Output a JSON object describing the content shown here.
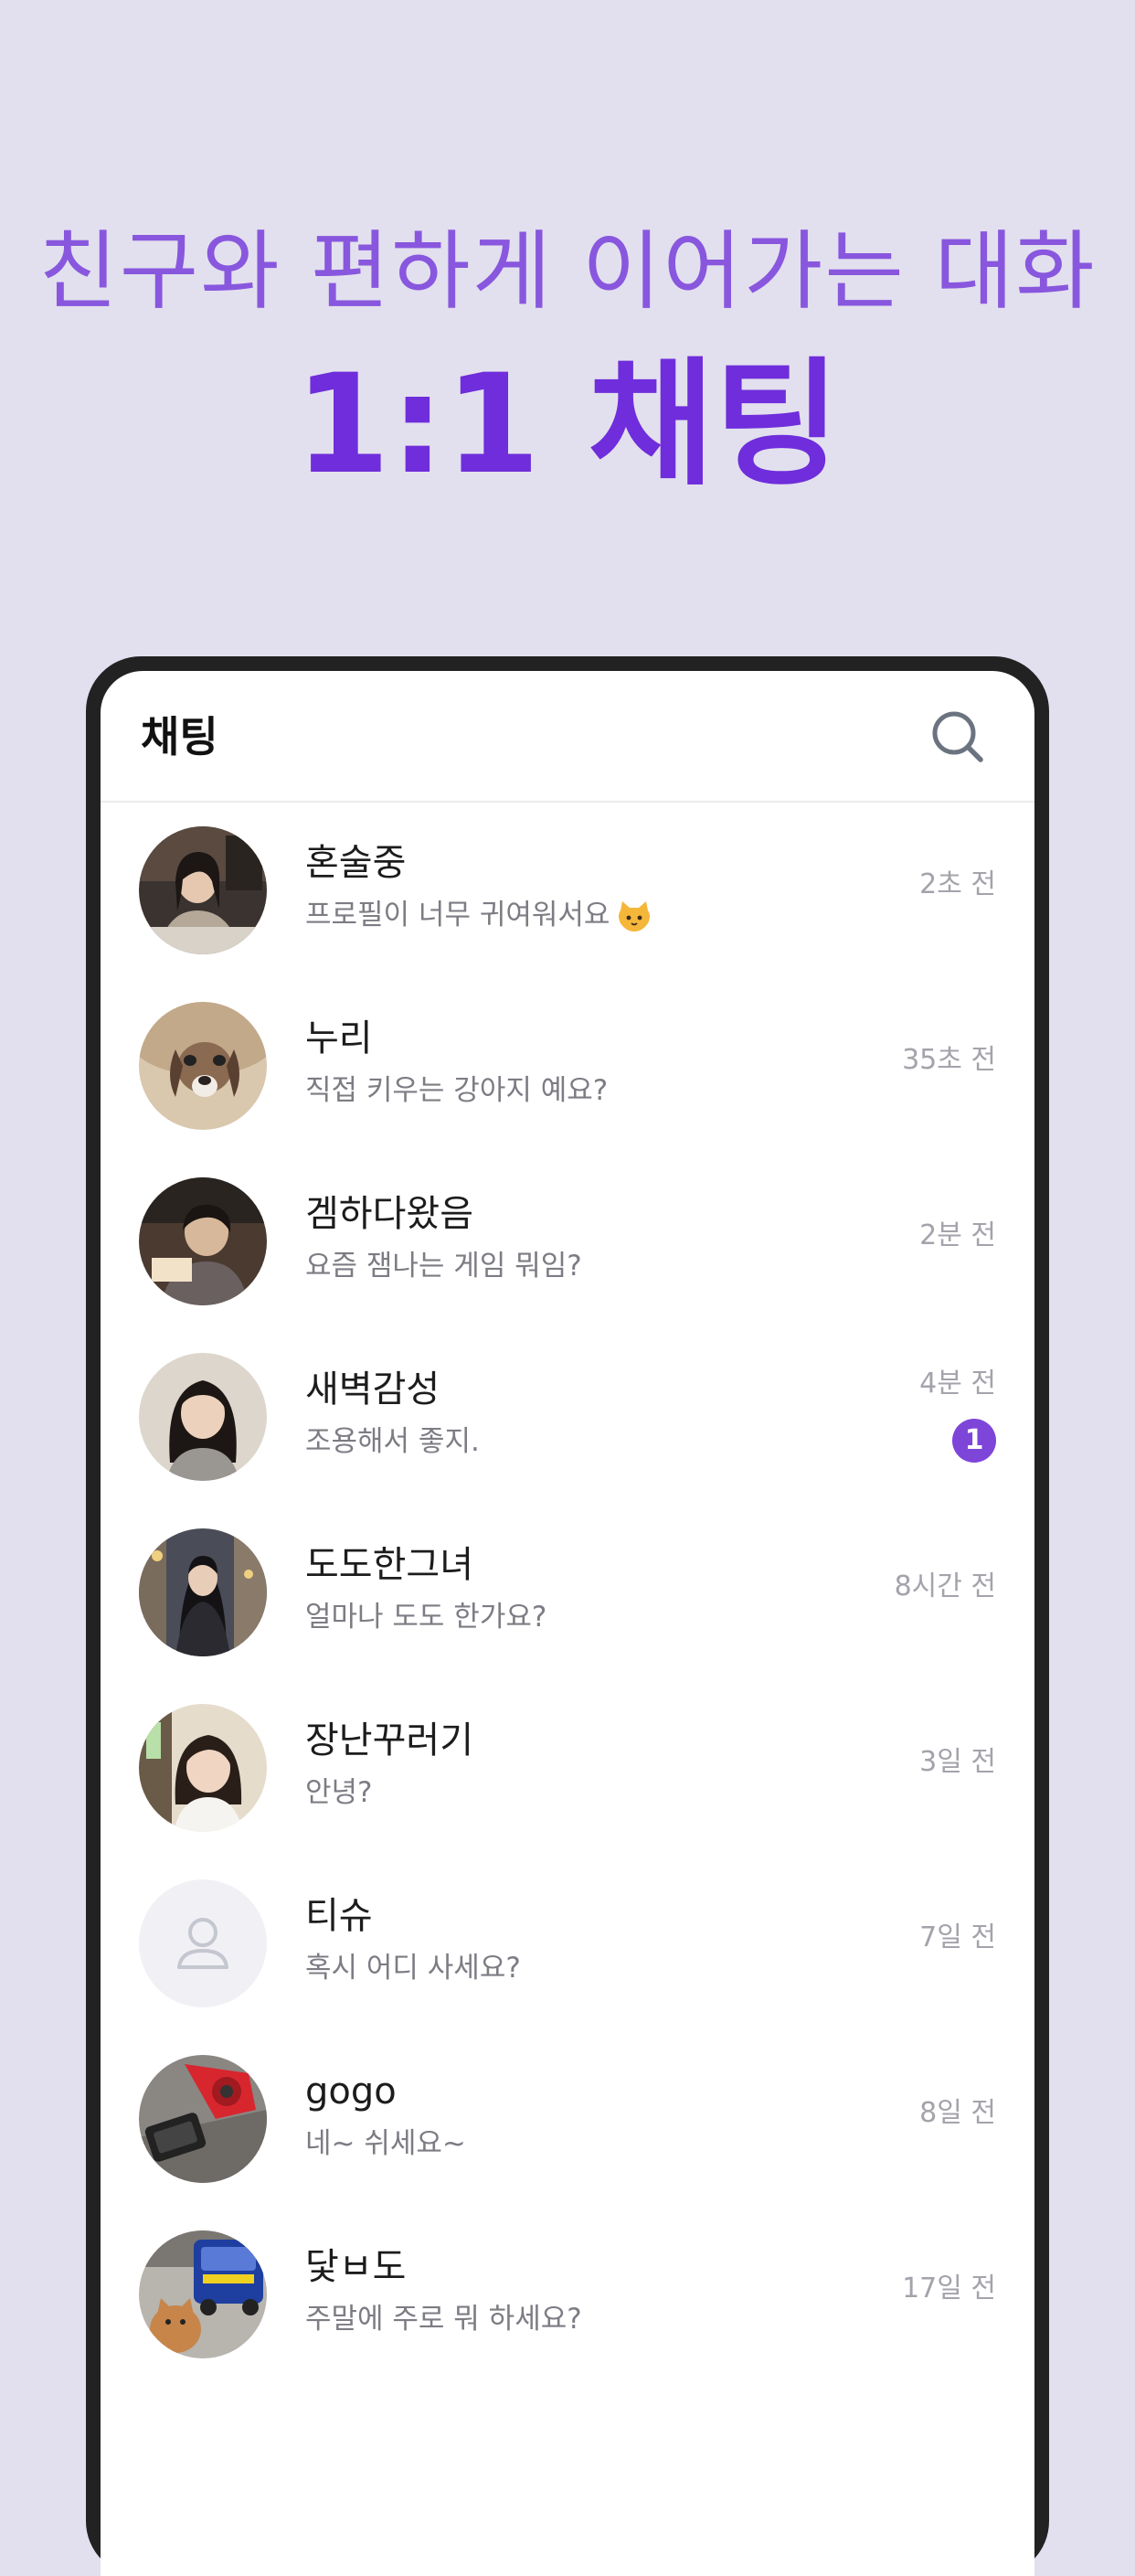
{
  "promo": {
    "subtitle": "친구와 편하게 이어가는 대화",
    "title": "1:1 채팅"
  },
  "header": {
    "title": "채팅",
    "search_icon": "search-icon"
  },
  "colors": {
    "accent": "#6f2ddb",
    "subtitle": "#8857de",
    "badge": "#7e45d9",
    "background": "#e2e0ee"
  },
  "chats": [
    {
      "name": "혼술중",
      "message": "프로필이 너무 귀여워서요",
      "emoji": "cat-face-icon",
      "time": "2초 전"
    },
    {
      "name": "누리",
      "message": "직접 키우는 강아지 예요?",
      "time": "35초 전"
    },
    {
      "name": "겜하다왔음",
      "message": "요즘 잼나는 게임 뭐임?",
      "time": "2분 전"
    },
    {
      "name": "새벽감성",
      "message": "조용해서 좋지.",
      "time": "4분 전",
      "unread": "1"
    },
    {
      "name": "도도한그녀",
      "message": "얼마나 도도 한가요?",
      "time": "8시간 전"
    },
    {
      "name": "장난꾸러기",
      "message": "안녕?",
      "time": "3일 전"
    },
    {
      "name": "티슈",
      "message": "혹시 어디 사세요?",
      "time": "7일 전",
      "avatar": "default-user-icon"
    },
    {
      "name": "gogo",
      "message": "네~ 쉬세요~",
      "time": "8일 전"
    },
    {
      "name": "닻ㅂ도",
      "message": "주말에 주로 뭐 하세요?",
      "time": "17일 전"
    }
  ]
}
